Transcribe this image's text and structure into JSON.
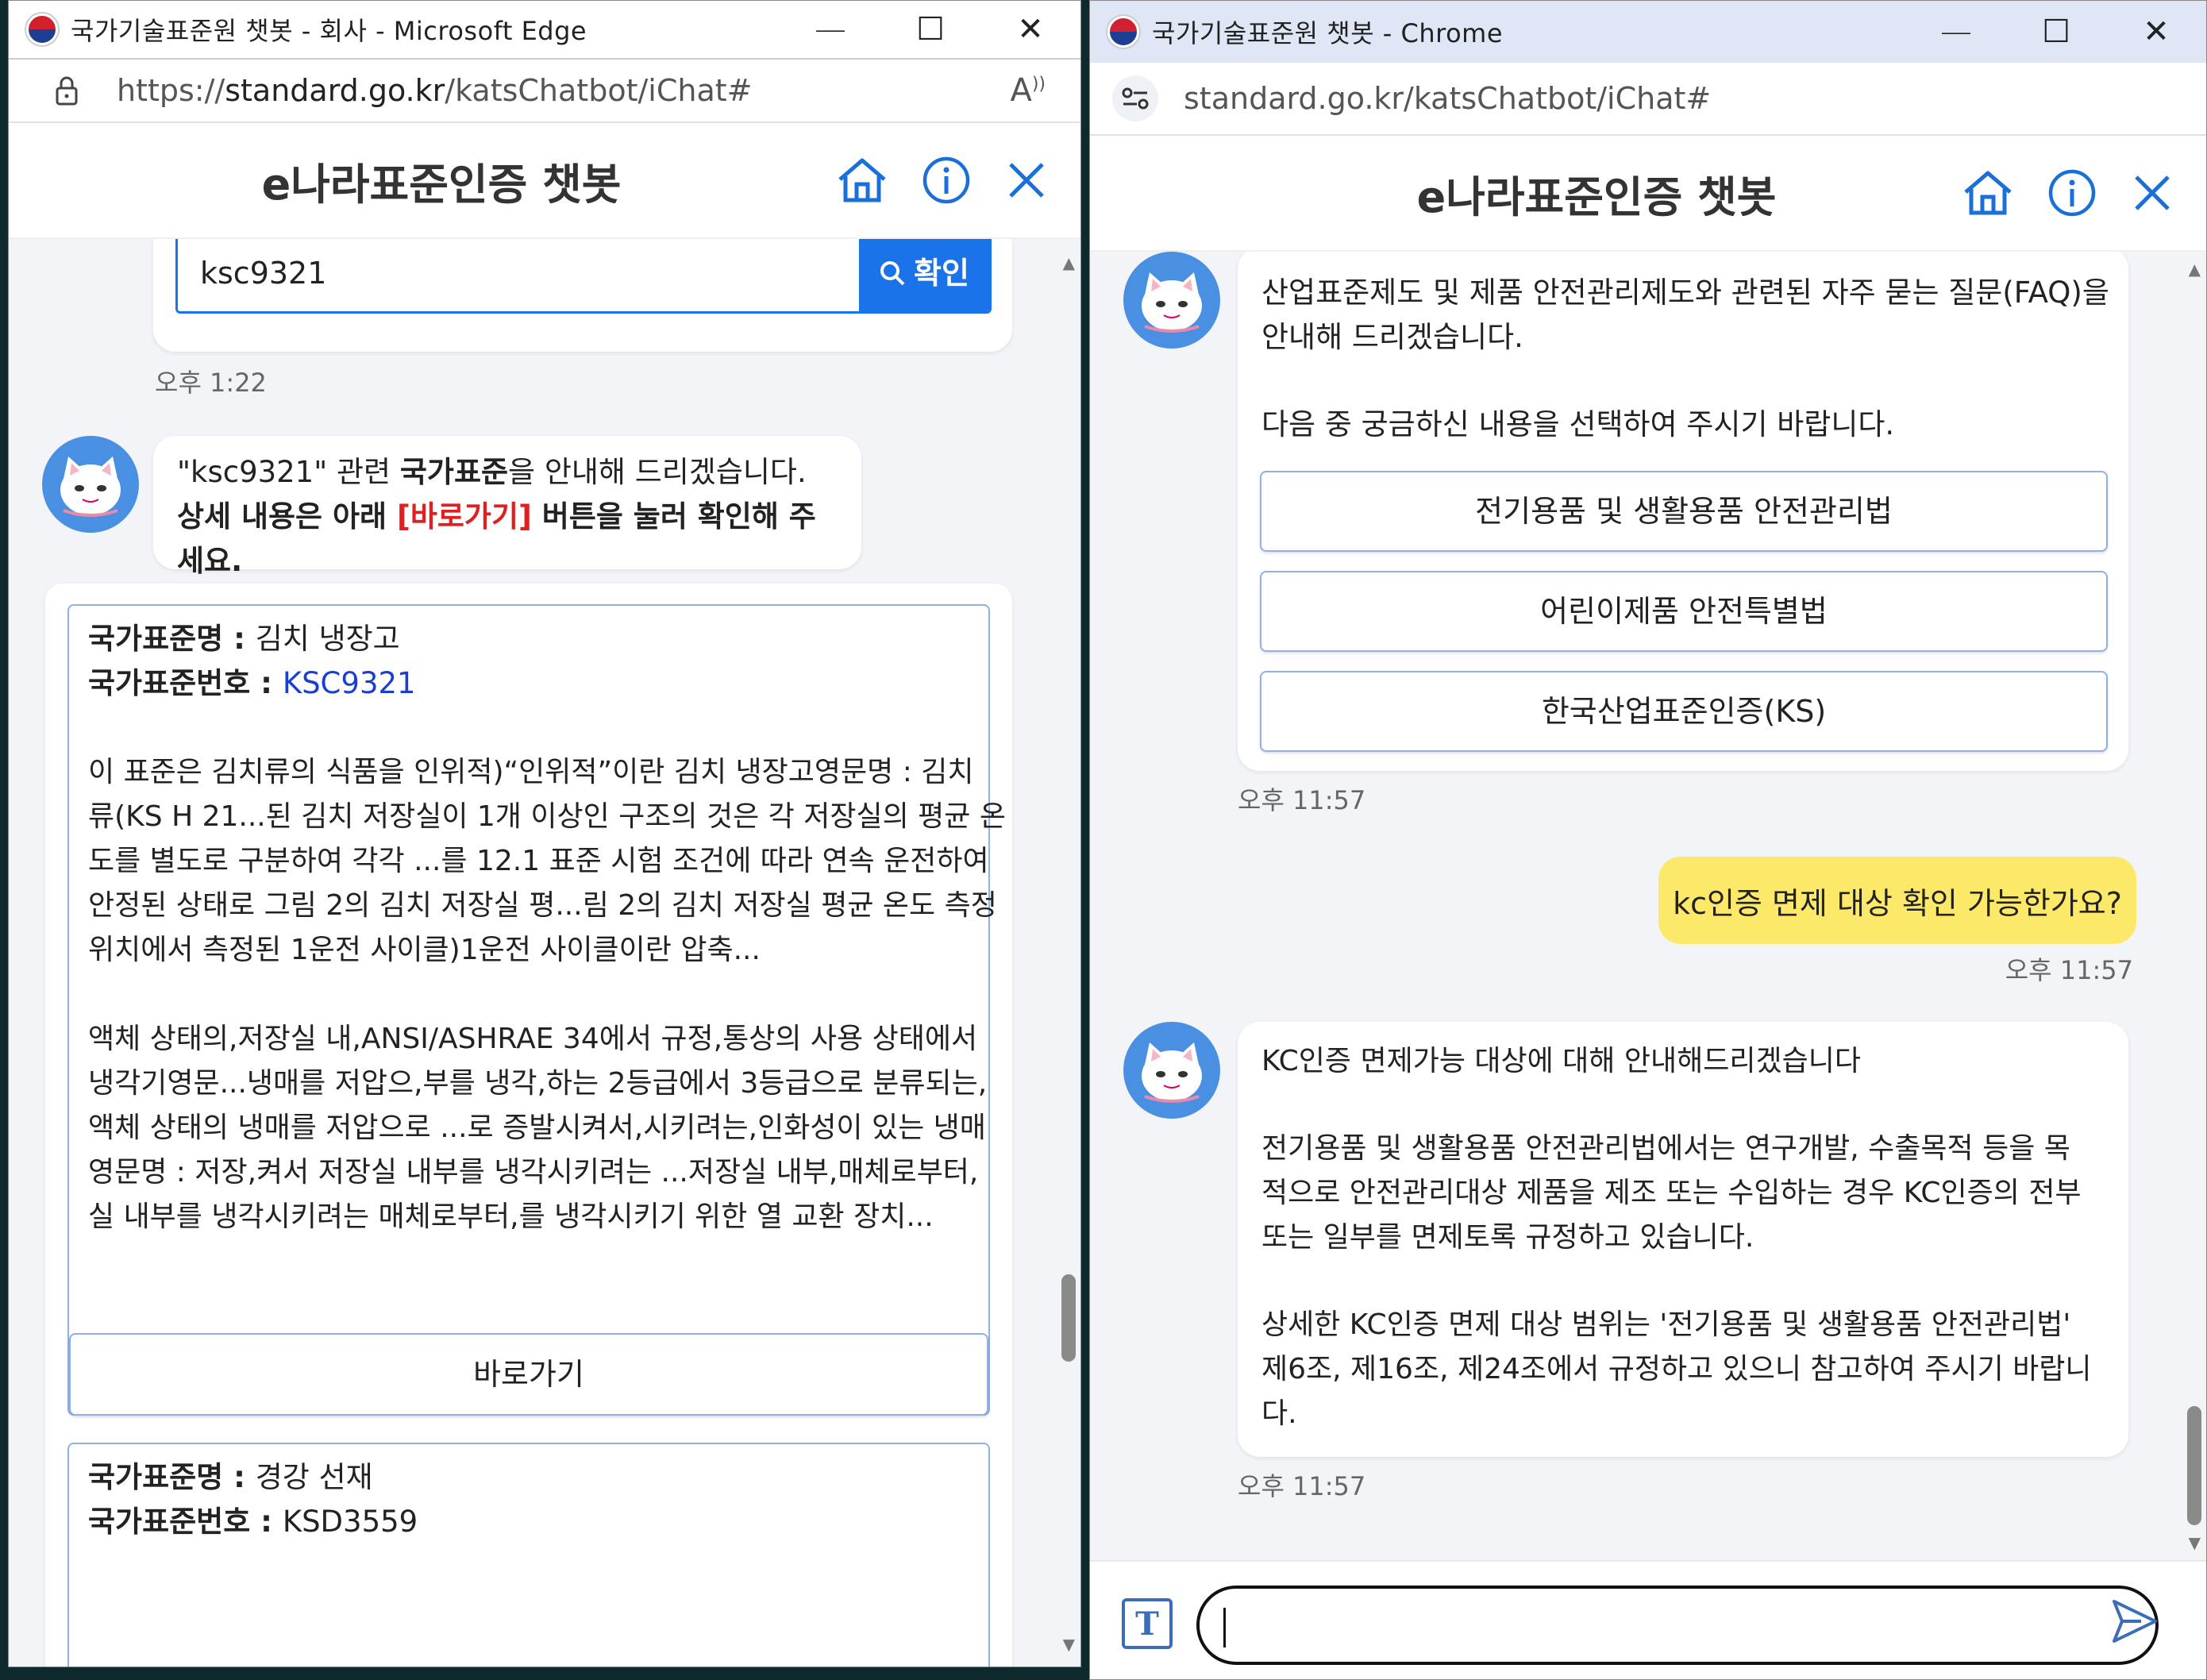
{
  "left_window": {
    "title": "국가기술표준원 챗봇 - 회사 - Microsoft Edge",
    "url_prefix": "https://",
    "url_host": "standard.go.kr",
    "url_path": "/katsChatbot/iChat#",
    "chat_title": "e나라표준인증 챗봇",
    "search_value": "ksc9321",
    "search_button_label": "확인",
    "search_time": "오후 1:22",
    "reply_line1_a": "\"ksc9321\" 관련 ",
    "reply_line1_b": "국가표준",
    "reply_line1_c": "을 안내해 드리겠습니다.",
    "reply_line2_a": "상세 내용은 아래 ",
    "reply_line2_b": "[바로가기]",
    "reply_line2_c": " 버튼을 눌러 확인해 주세요.",
    "results": [
      {
        "name_label": "국가표준명 : ",
        "name_value": "김치 냉장고",
        "number_label": "국가표준번호 : ",
        "number_value": "KSC9321",
        "para1": [
          "이 표준은 김치류의 식품을 인위적)“인위적”이란 김치 냉장고영문명 : 김치",
          "류(KS H 21...된 김치 저장실이 1개 이상인 구조의 것은 각 저장실의 평균 온",
          "도를 별도로 구분하여 각각 ...를 12.1 표준 시험 조건에 따라 연속 운전하여",
          "안정된 상태로 그림 2의 김치 저장실 평...림 2의 김치 저장실 평균 온도 측정",
          "위치에서 측정된 1운전 사이클)1운전 사이클이란 압축..."
        ],
        "para2": [
          "액체 상태의,저장실 내,ANSI/ASHRAE 34에서 규정,통상의 사용 상태에서",
          "냉각기영문...냉매를 저압으,부를 냉각,하는 2등급에서 3등급으로 분류되는,",
          "액체 상태의 냉매를 저압으로 ...로 증발시켜서,시키려는,인화성이 있는 냉매",
          "영문명 : 저장,켜서 저장실 내부를 냉각시키려는 ...저장실 내부,매체로부터,",
          "실 내부를 냉각시키려는 매체로부터,를 냉각시키기 위한 열 교환 장치..."
        ],
        "button_label": "바로가기"
      },
      {
        "name_label": "국가표준명 : ",
        "name_value": "경강 선재",
        "number_label": "국가표준번호 : ",
        "number_value": "KSD3559"
      }
    ]
  },
  "right_window": {
    "title": "국가기술표준원 챗봇 - Chrome",
    "url": "standard.go.kr/katsChatbot/iChat#",
    "chat_title": "e나라표준인증 챗봇",
    "faq_intro_lines": [
      "산업표준제도 및 제품 안전관리제도와 관련된 자주 묻는 질문(FAQ)을",
      "안내해 드리겠습니다."
    ],
    "faq_prompt": "다음 중 궁금하신 내용을 선택하여 주시기 바랍니다.",
    "options": [
      "전기용품 및 생활용품 안전관리법",
      "어린이제품 안전특별법",
      "한국산업표준인증(KS)"
    ],
    "faq_time": "오후 11:57",
    "user_message": "kc인증 면제 대상 확인 가능한가요?",
    "user_time": "오후 11:57",
    "answer_line1": "KC인증 면제가능 대상에 대해 안내해드리겠습니다",
    "answer_para2": [
      "전기용품 및 생활용품 안전관리법에서는 연구개발, 수출목적 등을 목",
      "적으로 안전관리대상 제품을 제조 또는 수입하는 경우 KC인증의 전부",
      "또는 일부를 면제토록 규정하고 있습니다."
    ],
    "answer_para3": [
      "상세한 KC인증 면제 대상 범위는 '전기용품 및 생활용품 안전관리법'",
      "제6조, 제16조, 제24조에서 규정하고 있으니 참고하여 주시기 바랍니",
      "다."
    ],
    "answer_time": "오후 11:57",
    "input_value": ""
  },
  "colors": {
    "accent_blue": "#1a73e8",
    "link_blue": "#1a3fcf",
    "highlight_red": "#e02020",
    "user_bubble_yellow": "#fce96a",
    "chat_background": "#f2f4f8"
  },
  "icons": [
    "korea-logo-icon",
    "lock-icon",
    "read-aloud-icon",
    "site-info-icon",
    "home-icon",
    "info-icon",
    "close-icon",
    "search-icon",
    "text-mode-icon",
    "send-icon",
    "cat-avatar-icon"
  ]
}
